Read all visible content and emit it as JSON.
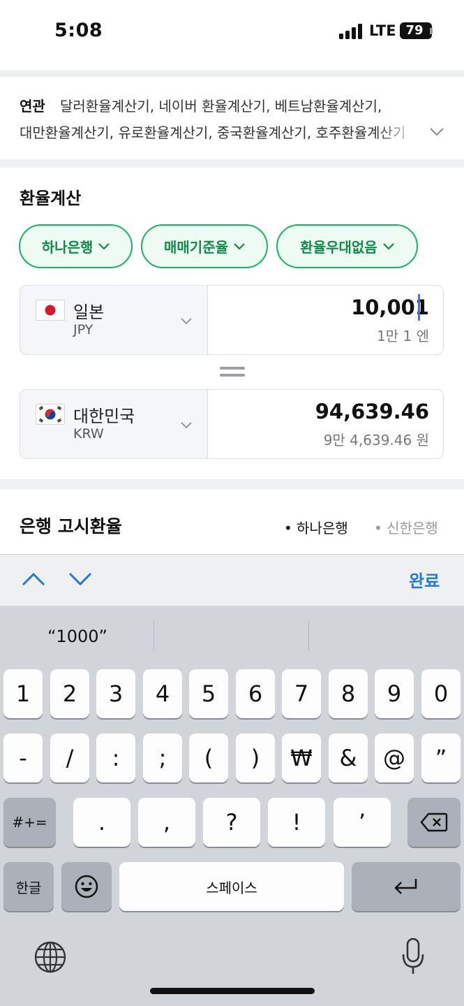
{
  "status": {
    "time": "5:08",
    "network": "LTE",
    "battery": "79"
  },
  "related": {
    "label": "연관",
    "line1": "달러환율계산기, 네이버 환율계산기, 베트남환율계산기,",
    "line2": "대만환율계산기, 유로환율계산기, 중국환율계산기, 호주환율계산기",
    "expand_icon": "chevron-down-icon"
  },
  "calculator": {
    "title": "환율계산",
    "chips": [
      "하나은행",
      "매매기준율",
      "환율우대없음"
    ],
    "from": {
      "country": "일본",
      "code": "JPY",
      "amount": "10,001",
      "amount_words": "1만 1 엔",
      "flag": "japan-flag"
    },
    "to": {
      "country": "대한민국",
      "code": "KRW",
      "amount": "94,639.46",
      "amount_words": "9만 4,639.46 원",
      "flag": "korea-flag"
    }
  },
  "bank": {
    "title": "은행 고시환율",
    "options": [
      "• 하나은행",
      "• 신한은행"
    ]
  },
  "keyboard": {
    "done": "완료",
    "suggestion": "“1000”",
    "row1": [
      "1",
      "2",
      "3",
      "4",
      "5",
      "6",
      "7",
      "8",
      "9",
      "0"
    ],
    "row2": [
      "-",
      "/",
      ":",
      ";",
      "(",
      ")",
      "₩",
      "&",
      "@",
      "”"
    ],
    "row3": [
      ".",
      ",",
      "?",
      "!",
      "’"
    ],
    "symbols_key": "#+=",
    "lang_key": "한글",
    "space": "스페이스"
  },
  "colors": {
    "accent_green": "#12b75f",
    "link_blue": "#1f7ae0"
  }
}
